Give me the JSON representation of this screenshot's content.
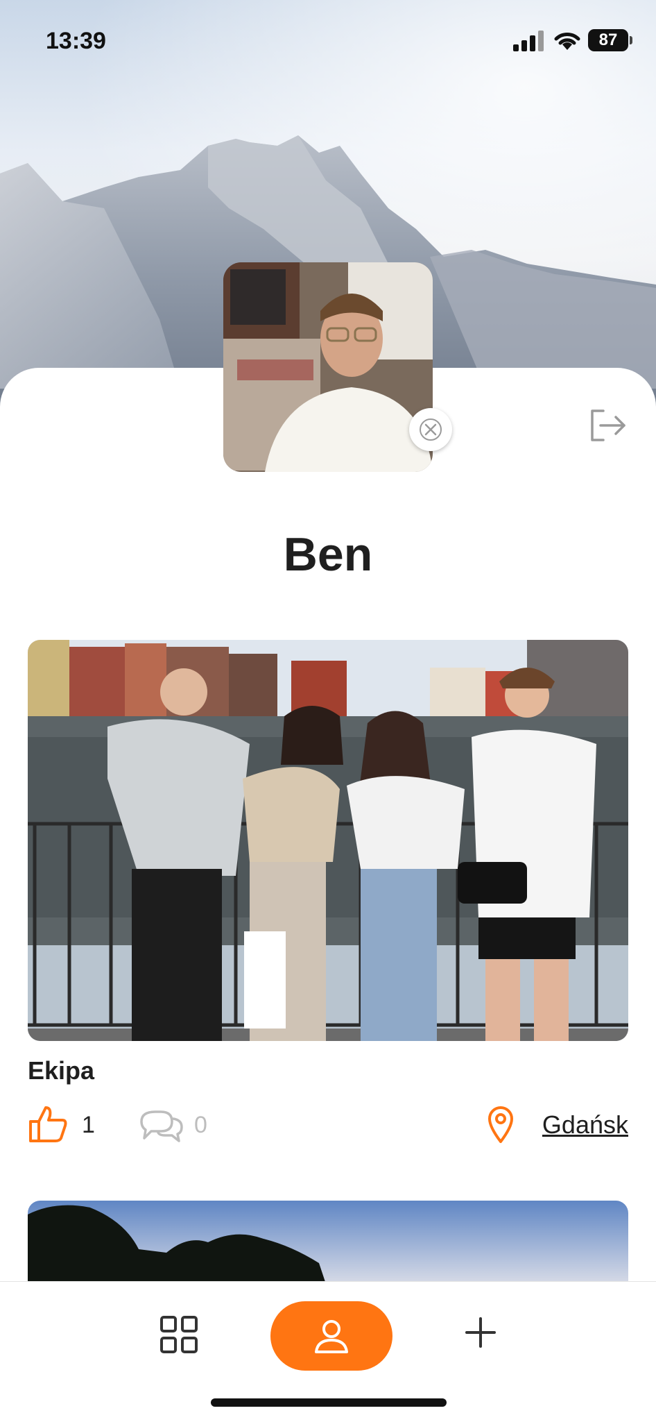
{
  "status_bar": {
    "time": "13:39",
    "battery": "87"
  },
  "profile": {
    "name": "Ben"
  },
  "posts": [
    {
      "title": "Ekipa",
      "likes": "1",
      "comments": "0",
      "location": "Gdańsk"
    }
  ],
  "colors": {
    "accent": "#ff7512",
    "muted": "#bdbdbd"
  },
  "icons": {
    "like": "thumbs-up-icon",
    "comment": "comment-icon",
    "location": "map-pin-icon",
    "logout": "logout-icon",
    "remove": "close-icon",
    "grid": "grid-icon",
    "profile": "user-icon",
    "add": "plus-icon"
  }
}
